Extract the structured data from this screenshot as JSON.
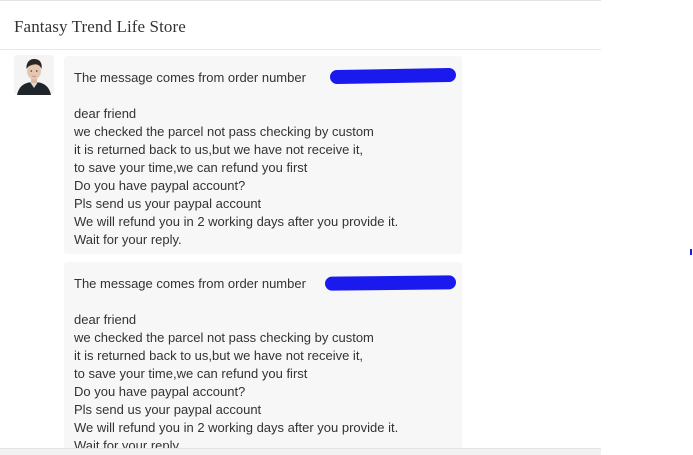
{
  "header": {
    "store_name": "Fantasy Trend Life Store"
  },
  "messages": [
    {
      "order_prefix": "The message comes from order number",
      "greeting": "dear friend",
      "lines": [
        "we checked the parcel not pass checking by custom",
        "it is returned back to us,but we have not receive it,",
        "to save your time,we can refund you first",
        "Do you have paypal account?",
        "Pls send us your paypal account",
        "We will refund you in 2 working days after you provide it.",
        "Wait for your reply."
      ]
    },
    {
      "order_prefix": "The message comes from order number",
      "greeting": "dear friend",
      "lines": [
        "we checked the parcel not pass checking by custom",
        "it is returned back to us,but we have not receive it,",
        "to save your time,we can refund you first",
        "Do you have paypal account?",
        "Pls send us your paypal account",
        "We will refund you in 2 working days after you provide it.",
        "Wait for your reply."
      ]
    }
  ],
  "colors": {
    "redaction": "#1a1aee",
    "bubble_bg": "#f7f7f7",
    "text": "#333333"
  }
}
